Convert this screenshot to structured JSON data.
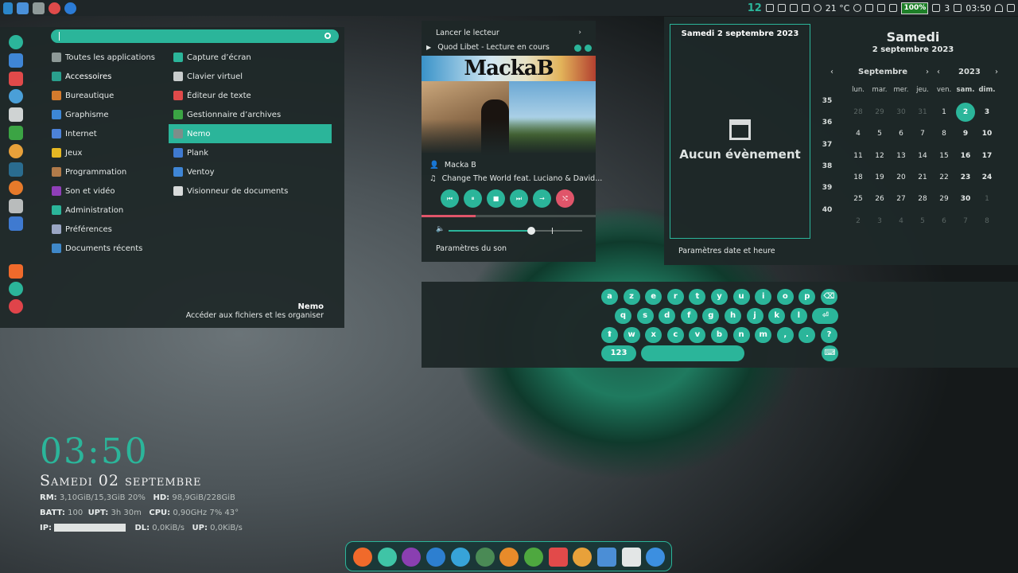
{
  "topbar": {
    "workspace": "12",
    "temperature": "21 °C",
    "battery": "100%",
    "notif_count": "3",
    "time": "03:50"
  },
  "menu": {
    "search_value": "",
    "categories": [
      {
        "label": "Toutes les applications",
        "icon": "grid-icon",
        "color": "#8e9997"
      },
      {
        "label": "Accessoires",
        "icon": "accessories-icon",
        "color": "#2a9f8d"
      },
      {
        "label": "Bureautique",
        "icon": "office-icon",
        "color": "#d47b2d"
      },
      {
        "label": "Graphisme",
        "icon": "graphics-icon",
        "color": "#3d87d6"
      },
      {
        "label": "Internet",
        "icon": "internet-icon",
        "color": "#4c82d9"
      },
      {
        "label": "Jeux",
        "icon": "games-icon",
        "color": "#e6b823"
      },
      {
        "label": "Programmation",
        "icon": "programming-icon",
        "color": "#b17b4a"
      },
      {
        "label": "Son et vidéo",
        "icon": "multimedia-icon",
        "color": "#8f3fb9"
      },
      {
        "label": "Administration",
        "icon": "admin-icon",
        "color": "#2bb59a"
      },
      {
        "label": "Préférences",
        "icon": "preferences-icon",
        "color": "#9aa6c4"
      },
      {
        "label": "Documents récents",
        "icon": "recent-docs-icon",
        "color": "#3f88c9"
      }
    ],
    "apps": [
      {
        "label": "Capture d’écran",
        "icon": "screenshot-icon",
        "color": "#2bb59a"
      },
      {
        "label": "Clavier virtuel",
        "icon": "keyboard-icon",
        "color": "#c8cccc"
      },
      {
        "label": "Éditeur de texte",
        "icon": "text-editor-icon",
        "color": "#e04a4a"
      },
      {
        "label": "Gestionnaire d’archives",
        "icon": "archive-icon",
        "color": "#3ba444"
      },
      {
        "label": "Nemo",
        "icon": "nemo-icon",
        "color": "#7d8d8a"
      },
      {
        "label": "Plank",
        "icon": "plank-icon",
        "color": "#3f7ad0"
      },
      {
        "label": "Ventoy",
        "icon": "ventoy-icon",
        "color": "#3f86d6"
      },
      {
        "label": "Visionneur de documents",
        "icon": "document-viewer-icon",
        "color": "#d8dbdb"
      }
    ],
    "desc_title": "Nemo",
    "desc_text": "Accéder aux fichiers et les organiser"
  },
  "sound": {
    "launch_player": "Lancer le lecteur",
    "now_playing": "Quod Libet - Lecture en cours",
    "cover_title": "MackaB",
    "artist": "Macka B",
    "track": "Change The World feat. Luciano & David...",
    "progress": 0.31,
    "volume": 0.62,
    "settings": "Paramètres du son"
  },
  "calendar": {
    "events_date": "Samedi 2 septembre 2023",
    "no_events": "Aucun évènement",
    "footer": "Paramètres date et heure",
    "day_name": "Samedi",
    "full_date": "2 septembre 2023",
    "month": "Septembre",
    "year": "2023",
    "weekdays": [
      "lun.",
      "mar.",
      "mer.",
      "jeu.",
      "ven.",
      "sam.",
      "dim."
    ],
    "weeks": [
      "35",
      "36",
      "37",
      "38",
      "39",
      "40"
    ],
    "days": [
      [
        "28",
        "29",
        "30",
        "31",
        "1",
        "2",
        "3"
      ],
      [
        "4",
        "5",
        "6",
        "7",
        "8",
        "9",
        "10"
      ],
      [
        "11",
        "12",
        "13",
        "14",
        "15",
        "16",
        "17"
      ],
      [
        "18",
        "19",
        "20",
        "21",
        "22",
        "23",
        "24"
      ],
      [
        "25",
        "26",
        "27",
        "28",
        "29",
        "30",
        "1"
      ],
      [
        "2",
        "3",
        "4",
        "5",
        "6",
        "7",
        "8"
      ]
    ],
    "today": "2"
  },
  "keyboard": {
    "row1": [
      "a",
      "z",
      "e",
      "r",
      "t",
      "y",
      "u",
      "i",
      "o",
      "p",
      "⌫"
    ],
    "row2": [
      "q",
      "s",
      "d",
      "f",
      "g",
      "h",
      "j",
      "k",
      "l",
      "⏎"
    ],
    "row3": [
      "⬆",
      "w",
      "x",
      "c",
      "v",
      "b",
      "n",
      "m",
      ",",
      ".",
      "?"
    ],
    "numbers_key": "123",
    "hide_key": "⌨"
  },
  "conky": {
    "time": "03:50",
    "date": "Samedi 02 septembre",
    "ram_label": "RM:",
    "ram_value": "3,10GiB/15,3GiB 20%",
    "hd_label": "HD:",
    "hd_value": "98,9GiB/228GiB",
    "batt_label": "BATT:",
    "batt_value": "100",
    "upt_label": "UPT:",
    "upt_value": "3h 30m",
    "cpu_label": "CPU:",
    "cpu_value": "0,90GHz 7% 43°",
    "ip_label": "IP:",
    "dl_label": "DL:",
    "dl_value": "0,0KiB/s",
    "up_label": "UP:",
    "up_value": "0,0KiB/s"
  },
  "dock": {
    "items": [
      {
        "name": "brave-icon",
        "color": "#f06a2b"
      },
      {
        "name": "mail-icon",
        "color": "#3fc4a6"
      },
      {
        "name": "media-player-icon",
        "color": "#8a3fb1"
      },
      {
        "name": "qbittorrent-icon",
        "color": "#2d7fd0"
      },
      {
        "name": "browser-icon",
        "color": "#37a3d8"
      },
      {
        "name": "music-icon",
        "color": "#4a8a55"
      },
      {
        "name": "gimp-icon",
        "color": "#e88b2a"
      },
      {
        "name": "maps-icon",
        "color": "#4ea83f"
      },
      {
        "name": "calendar-icon",
        "color": "#e24a4a"
      },
      {
        "name": "home-folder-icon",
        "color": "#e8a13a"
      },
      {
        "name": "monitor-icon",
        "color": "#4b8ed6"
      },
      {
        "name": "text-editor-icon",
        "color": "#e3e6e6"
      },
      {
        "name": "network-icon",
        "color": "#3c8fe0"
      }
    ]
  },
  "launcher": {
    "items": [
      {
        "name": "settings-icon",
        "color": "#2bb59a"
      },
      {
        "name": "list-icon",
        "color": "#3f86d6"
      },
      {
        "name": "tasks-icon",
        "color": "#e04a4a"
      },
      {
        "name": "dolphin-icon",
        "color": "#4a9fd8"
      },
      {
        "name": "screenshot-icon",
        "color": "#cfd3d3"
      },
      {
        "name": "archive-icon",
        "color": "#3ba444"
      },
      {
        "name": "home-icon",
        "color": "#e8a13a"
      },
      {
        "name": "terminal-icon",
        "color": "#2a6c8f"
      },
      {
        "name": "firefox-icon",
        "color": "#e77a2a"
      },
      {
        "name": "drive-icon",
        "color": "#b9bcbc"
      },
      {
        "name": "usb-icon",
        "color": "#3f7ad0"
      }
    ],
    "bottom": [
      {
        "name": "lock-icon",
        "color": "#f06a2b"
      },
      {
        "name": "logout-icon",
        "color": "#2bb59a"
      },
      {
        "name": "power-icon",
        "color": "#e0444a"
      }
    ]
  }
}
